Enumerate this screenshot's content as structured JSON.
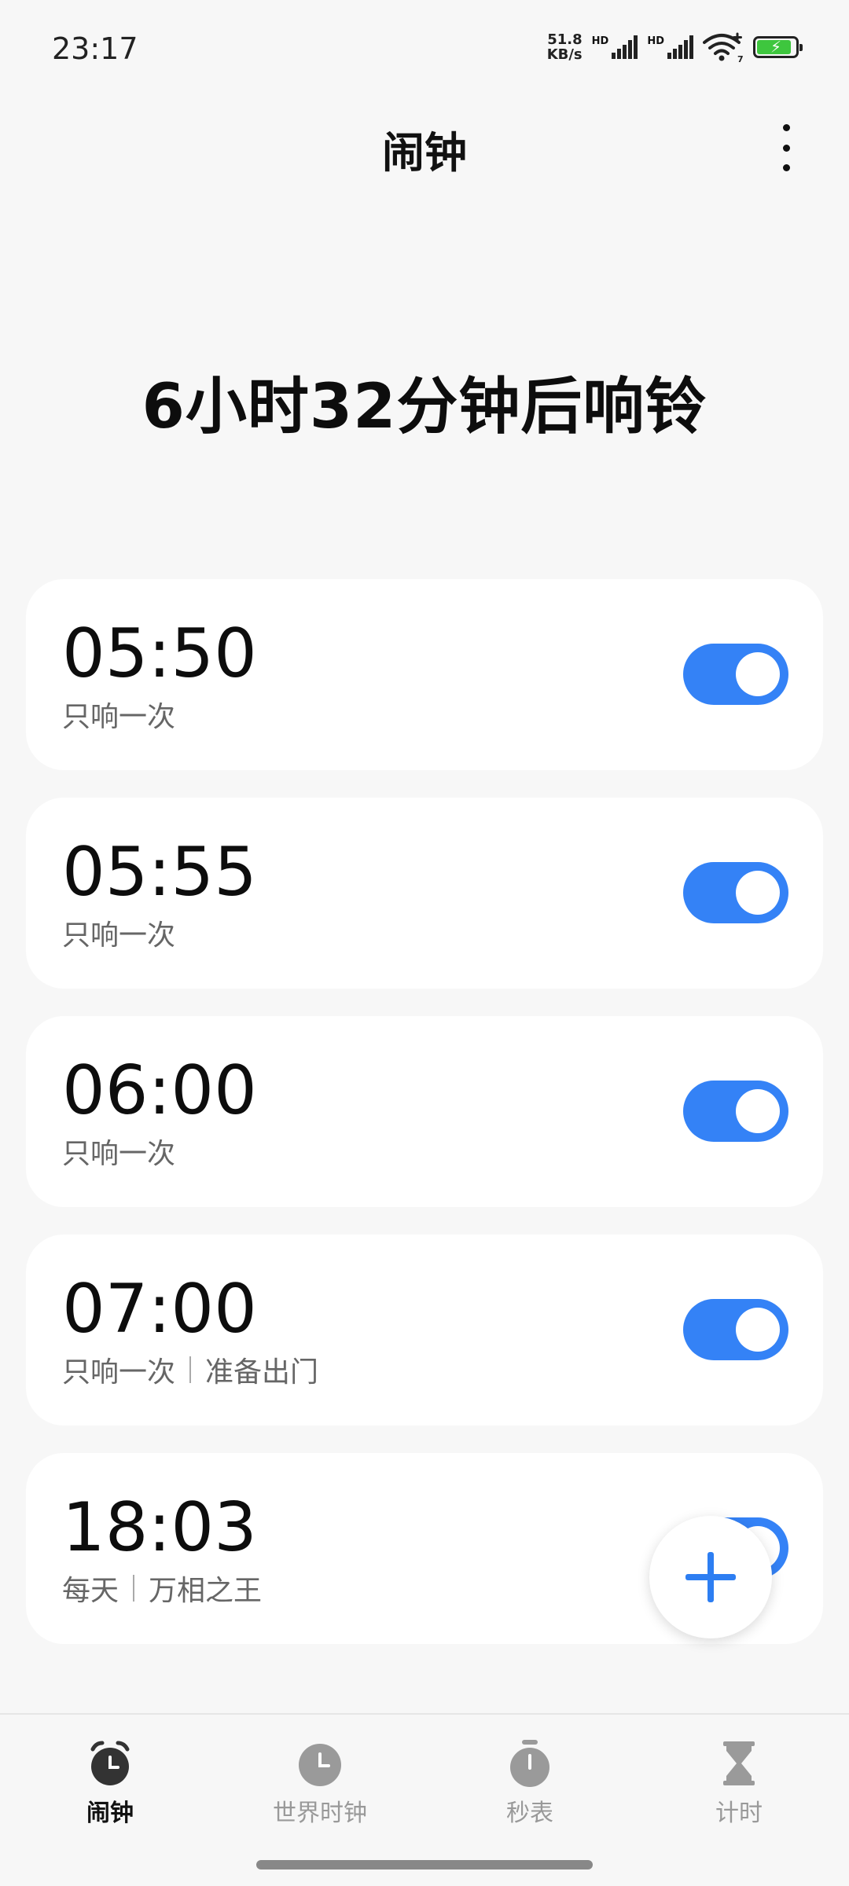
{
  "status_bar": {
    "time": "23:17",
    "net_speed_value": "51.8",
    "net_speed_unit": "KB/s",
    "sim1_label": "HD",
    "sim2_label": "HD",
    "wifi_badge": "7",
    "battery_level": 0.82,
    "battery_color": "#3ec63e"
  },
  "header": {
    "title": "闹钟",
    "more_icon": "more-vertical-icon"
  },
  "next_alarm_text": "6小时32分钟后响铃",
  "accent_color": "#3482f6",
  "alarms": [
    {
      "time": "05:50",
      "repeat": "只响一次",
      "label": "",
      "enabled": true
    },
    {
      "time": "05:55",
      "repeat": "只响一次",
      "label": "",
      "enabled": true
    },
    {
      "time": "06:00",
      "repeat": "只响一次",
      "label": "",
      "enabled": true
    },
    {
      "time": "07:00",
      "repeat": "只响一次",
      "label": "准备出门",
      "enabled": true
    },
    {
      "time": "18:03",
      "repeat": "每天",
      "label": "万相之王",
      "enabled": true
    }
  ],
  "fab_icon": "plus-icon",
  "nav": [
    {
      "label": "闹钟",
      "icon": "alarm-clock-icon",
      "active": true
    },
    {
      "label": "世界时钟",
      "icon": "world-clock-icon",
      "active": false
    },
    {
      "label": "秒表",
      "icon": "stopwatch-icon",
      "active": false
    },
    {
      "label": "计时",
      "icon": "hourglass-icon",
      "active": false
    }
  ]
}
